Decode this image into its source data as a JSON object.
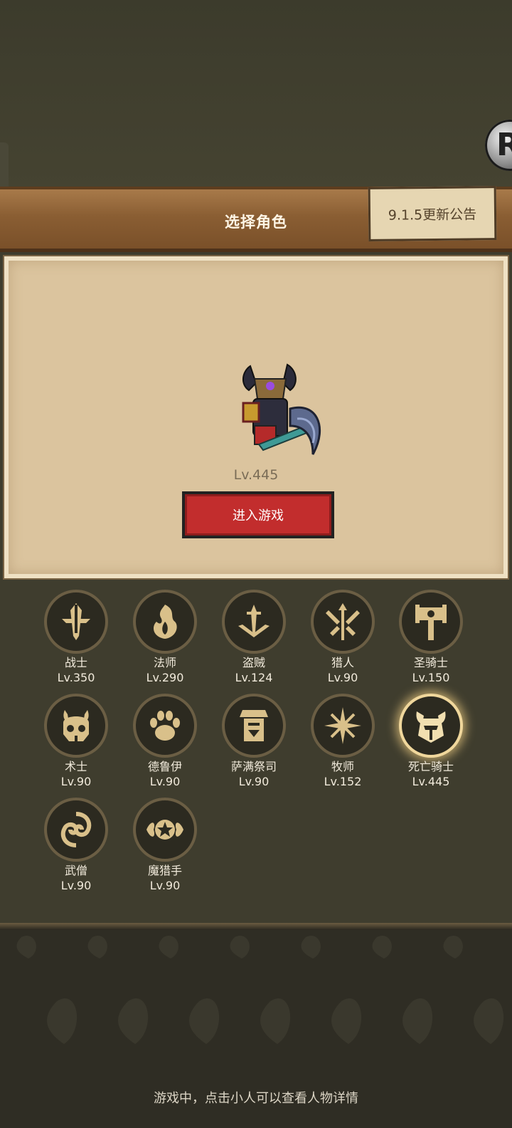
{
  "header": {
    "title": "选择角色",
    "notice_label": "9.1.5更新公告"
  },
  "floating_button": {
    "icon": "game-assistant-icon"
  },
  "selected_character": {
    "level": "Lv.445",
    "enter_label": "进入游戏"
  },
  "classes": [
    {
      "name": "战士",
      "level": "Lv.350",
      "icon": "warrior-sword-icon"
    },
    {
      "name": "法师",
      "level": "Lv.290",
      "icon": "mage-flame-icon"
    },
    {
      "name": "盗贼",
      "level": "Lv.124",
      "icon": "rogue-dagger-icon"
    },
    {
      "name": "猎人",
      "level": "Lv.90",
      "icon": "hunter-arrows-icon"
    },
    {
      "name": "圣骑士",
      "level": "Lv.150",
      "icon": "paladin-hammer-icon"
    },
    {
      "name": "术士",
      "level": "Lv.90",
      "icon": "warlock-skull-icon"
    },
    {
      "name": "德鲁伊",
      "level": "Lv.90",
      "icon": "druid-paw-icon"
    },
    {
      "name": "萨满祭司",
      "level": "Lv.90",
      "icon": "shaman-totem-icon"
    },
    {
      "name": "牧师",
      "level": "Lv.152",
      "icon": "priest-star-icon"
    },
    {
      "name": "死亡骑士",
      "level": "Lv.445",
      "icon": "deathknight-helm-icon",
      "selected": true
    },
    {
      "name": "武僧",
      "level": "Lv.90",
      "icon": "monk-swirl-icon"
    },
    {
      "name": "魔猎手",
      "level": "Lv.90",
      "icon": "demonhunter-star-icon"
    }
  ],
  "footer_hint": "游戏中，点击小人可以查看人物详情",
  "colors": {
    "accent_red": "#c22d2d",
    "parchment": "#dbc49e",
    "gold": "#d9c08a"
  }
}
